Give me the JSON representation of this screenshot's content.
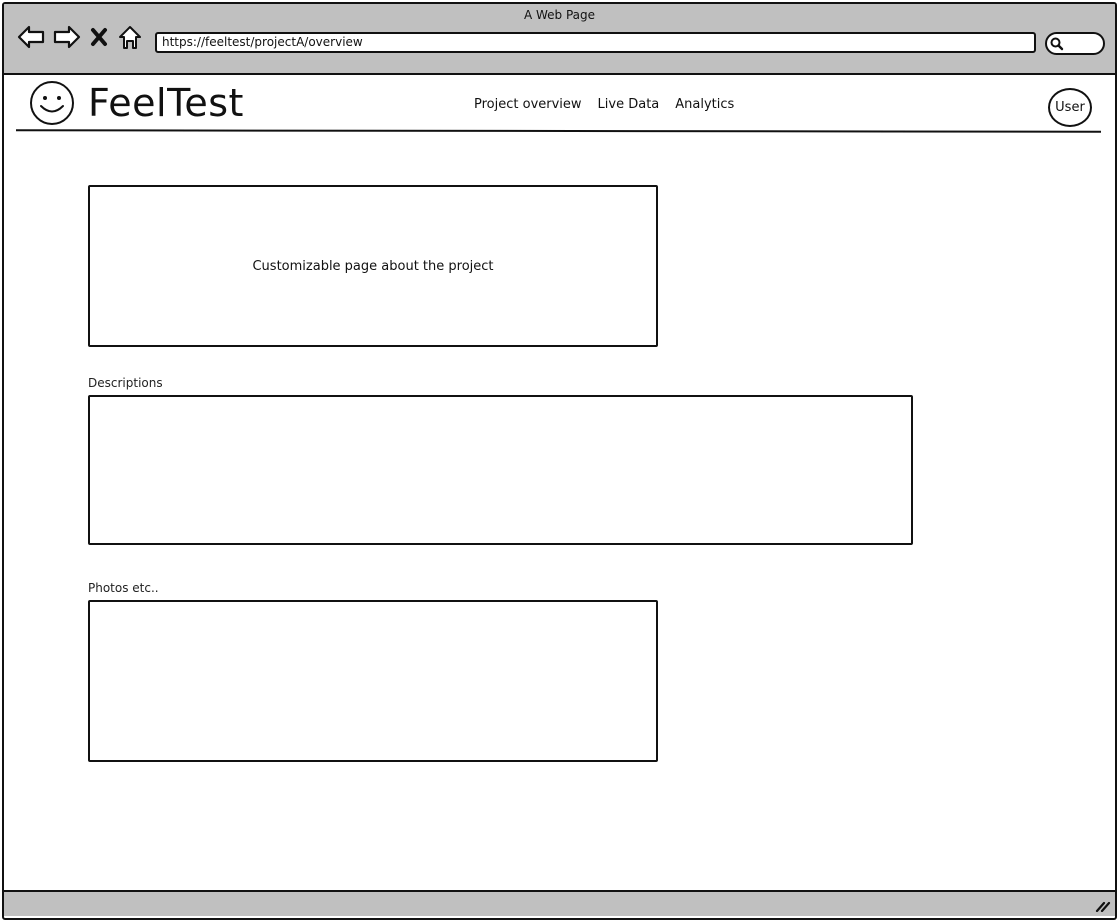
{
  "browser": {
    "window_title": "A Web Page",
    "url": "https://feeltest/projectA/overview",
    "icons": [
      "back-arrow-icon",
      "forward-arrow-icon",
      "stop-x-icon",
      "home-icon",
      "search-icon",
      "resize-grip-icon"
    ]
  },
  "app": {
    "brand": "FeelTest",
    "logo_icon": "smiley-face-icon",
    "nav": [
      "Project overview",
      "Live Data",
      "Analytics"
    ],
    "user_label": "User"
  },
  "content": {
    "hero_text": "Customizable page about the project",
    "descriptions_label": "Descriptions",
    "photos_label": "Photos etc.."
  }
}
